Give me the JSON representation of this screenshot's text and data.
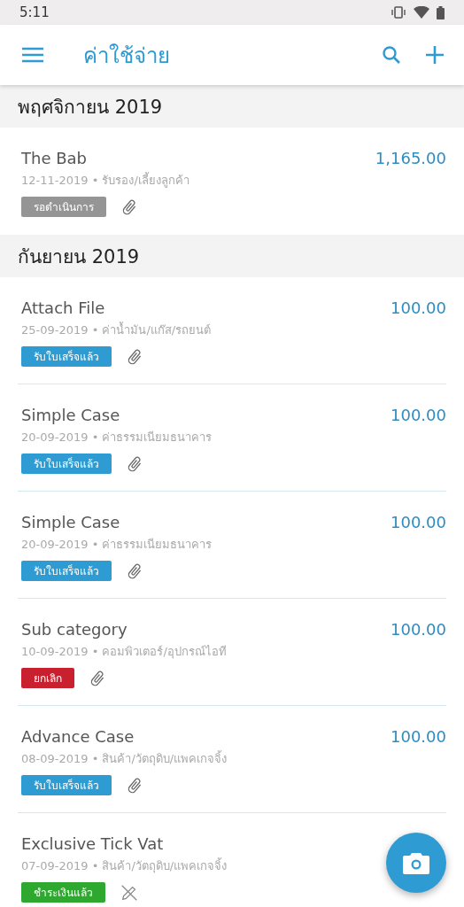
{
  "status_bar": {
    "time": "5:11"
  },
  "app_bar": {
    "title": "ค่าใช้จ่าย"
  },
  "sections": [
    {
      "title": "พฤศจิกายน 2019",
      "items": [
        {
          "name": "The Bab",
          "amount": "1,165.00",
          "subtitle": "12-11-2019 • รับรอง/เลี้ยงลูกค้า",
          "status": "รอดำเนินการ",
          "color": "#959595",
          "kind": "attachment"
        }
      ]
    },
    {
      "title": "กันยายน 2019",
      "items": [
        {
          "name": "Attach File",
          "amount": "100.00",
          "subtitle": "25-09-2019 • ค่าน้ำมัน/แก๊ส/รถยนต์",
          "status": "รับใบเสร็จแล้ว",
          "color": "#2e9bd2",
          "kind": "attachment"
        },
        {
          "name": "Simple Case",
          "amount": "100.00",
          "subtitle": "20-09-2019 • ค่าธรรมเนียมธนาคาร",
          "status": "รับใบเสร็จแล้ว",
          "color": "#2e9bd2",
          "kind": "attachment"
        },
        {
          "name": "Simple Case",
          "amount": "100.00",
          "subtitle": "20-09-2019 • ค่าธรรมเนียมธนาคาร",
          "status": "รับใบเสร็จแล้ว",
          "color": "#2e9bd2",
          "kind": "attachment"
        },
        {
          "name": "Sub category",
          "amount": "100.00",
          "subtitle": "10-09-2019 • คอมพิวเตอร์/อุปกรณ์ไอที",
          "status": "ยกเลิก",
          "color": "#c8202f",
          "kind": "attachment"
        },
        {
          "name": "Advance Case",
          "amount": "100.00",
          "subtitle": "08-09-2019 • สินค้า/วัตถุดิบ/แพคเกจจิ้ง",
          "status": "รับใบเสร็จแล้ว",
          "color": "#2e9bd2",
          "kind": "attachment"
        },
        {
          "name": "Exclusive Tick Vat",
          "subtitle": "07-09-2019 • สินค้า/วัตถุดิบ/แพคเกจจิ้ง",
          "status": "ชำระเงินแล้ว",
          "color": "#2ea82e",
          "kind": "no-edit"
        }
      ]
    }
  ]
}
